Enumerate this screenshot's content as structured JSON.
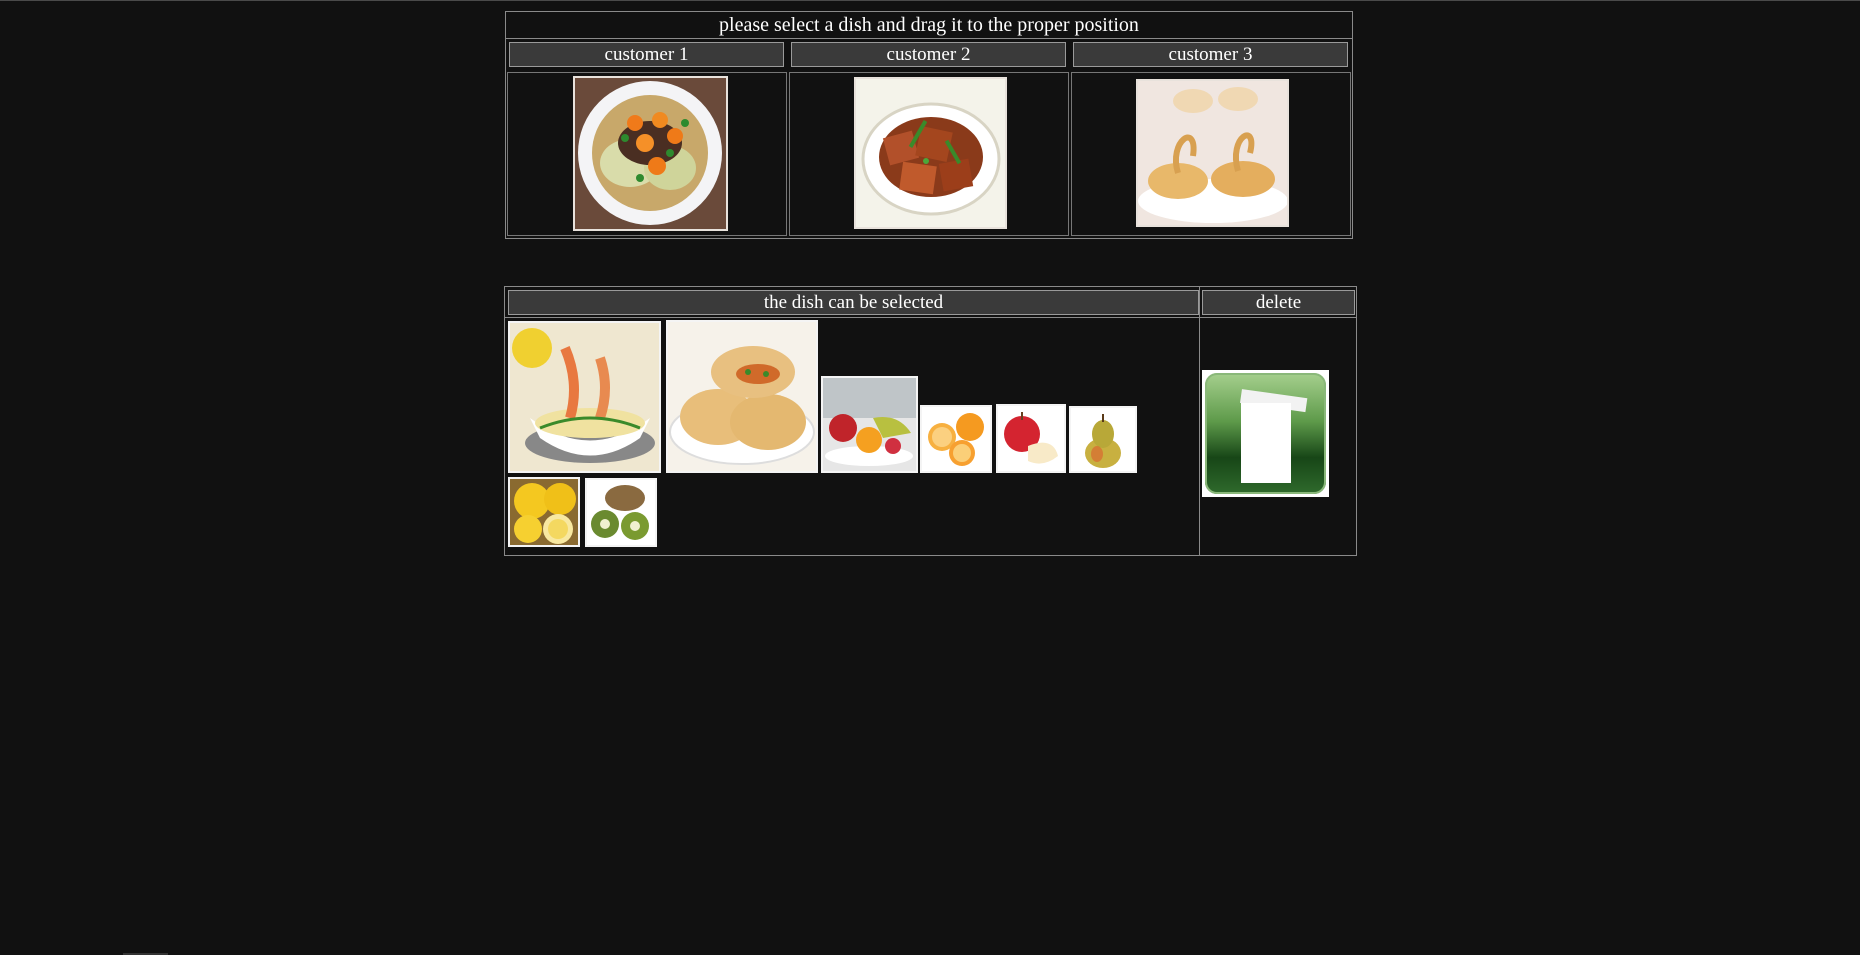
{
  "instruction": "please select a dish and drag it to the proper position",
  "customers": [
    {
      "label": "customer 1",
      "dish_icon": "braised-vegetable-dish-icon"
    },
    {
      "label": "customer 2",
      "dish_icon": "braised-tofu-dish-icon"
    },
    {
      "label": "customer 3",
      "dish_icon": "swan-cream-puff-dish-icon"
    }
  ],
  "dish_panel": {
    "header": "the dish can be selected",
    "dishes": [
      {
        "icon": "shrimp-dish-icon"
      },
      {
        "icon": "stuffed-pancake-dish-icon"
      },
      {
        "icon": "fruit-platter-icon"
      },
      {
        "icon": "orange-icon"
      },
      {
        "icon": "apple-icon"
      },
      {
        "icon": "pear-icon"
      },
      {
        "icon": "lemon-icon"
      },
      {
        "icon": "kiwi-icon"
      }
    ]
  },
  "delete_panel": {
    "header": "delete",
    "icon": "trash-can-icon"
  },
  "colors": {
    "background": "#111111",
    "header_fill": "#3a3a3a",
    "border": "#8a8a8a",
    "text": "#ffffff"
  }
}
